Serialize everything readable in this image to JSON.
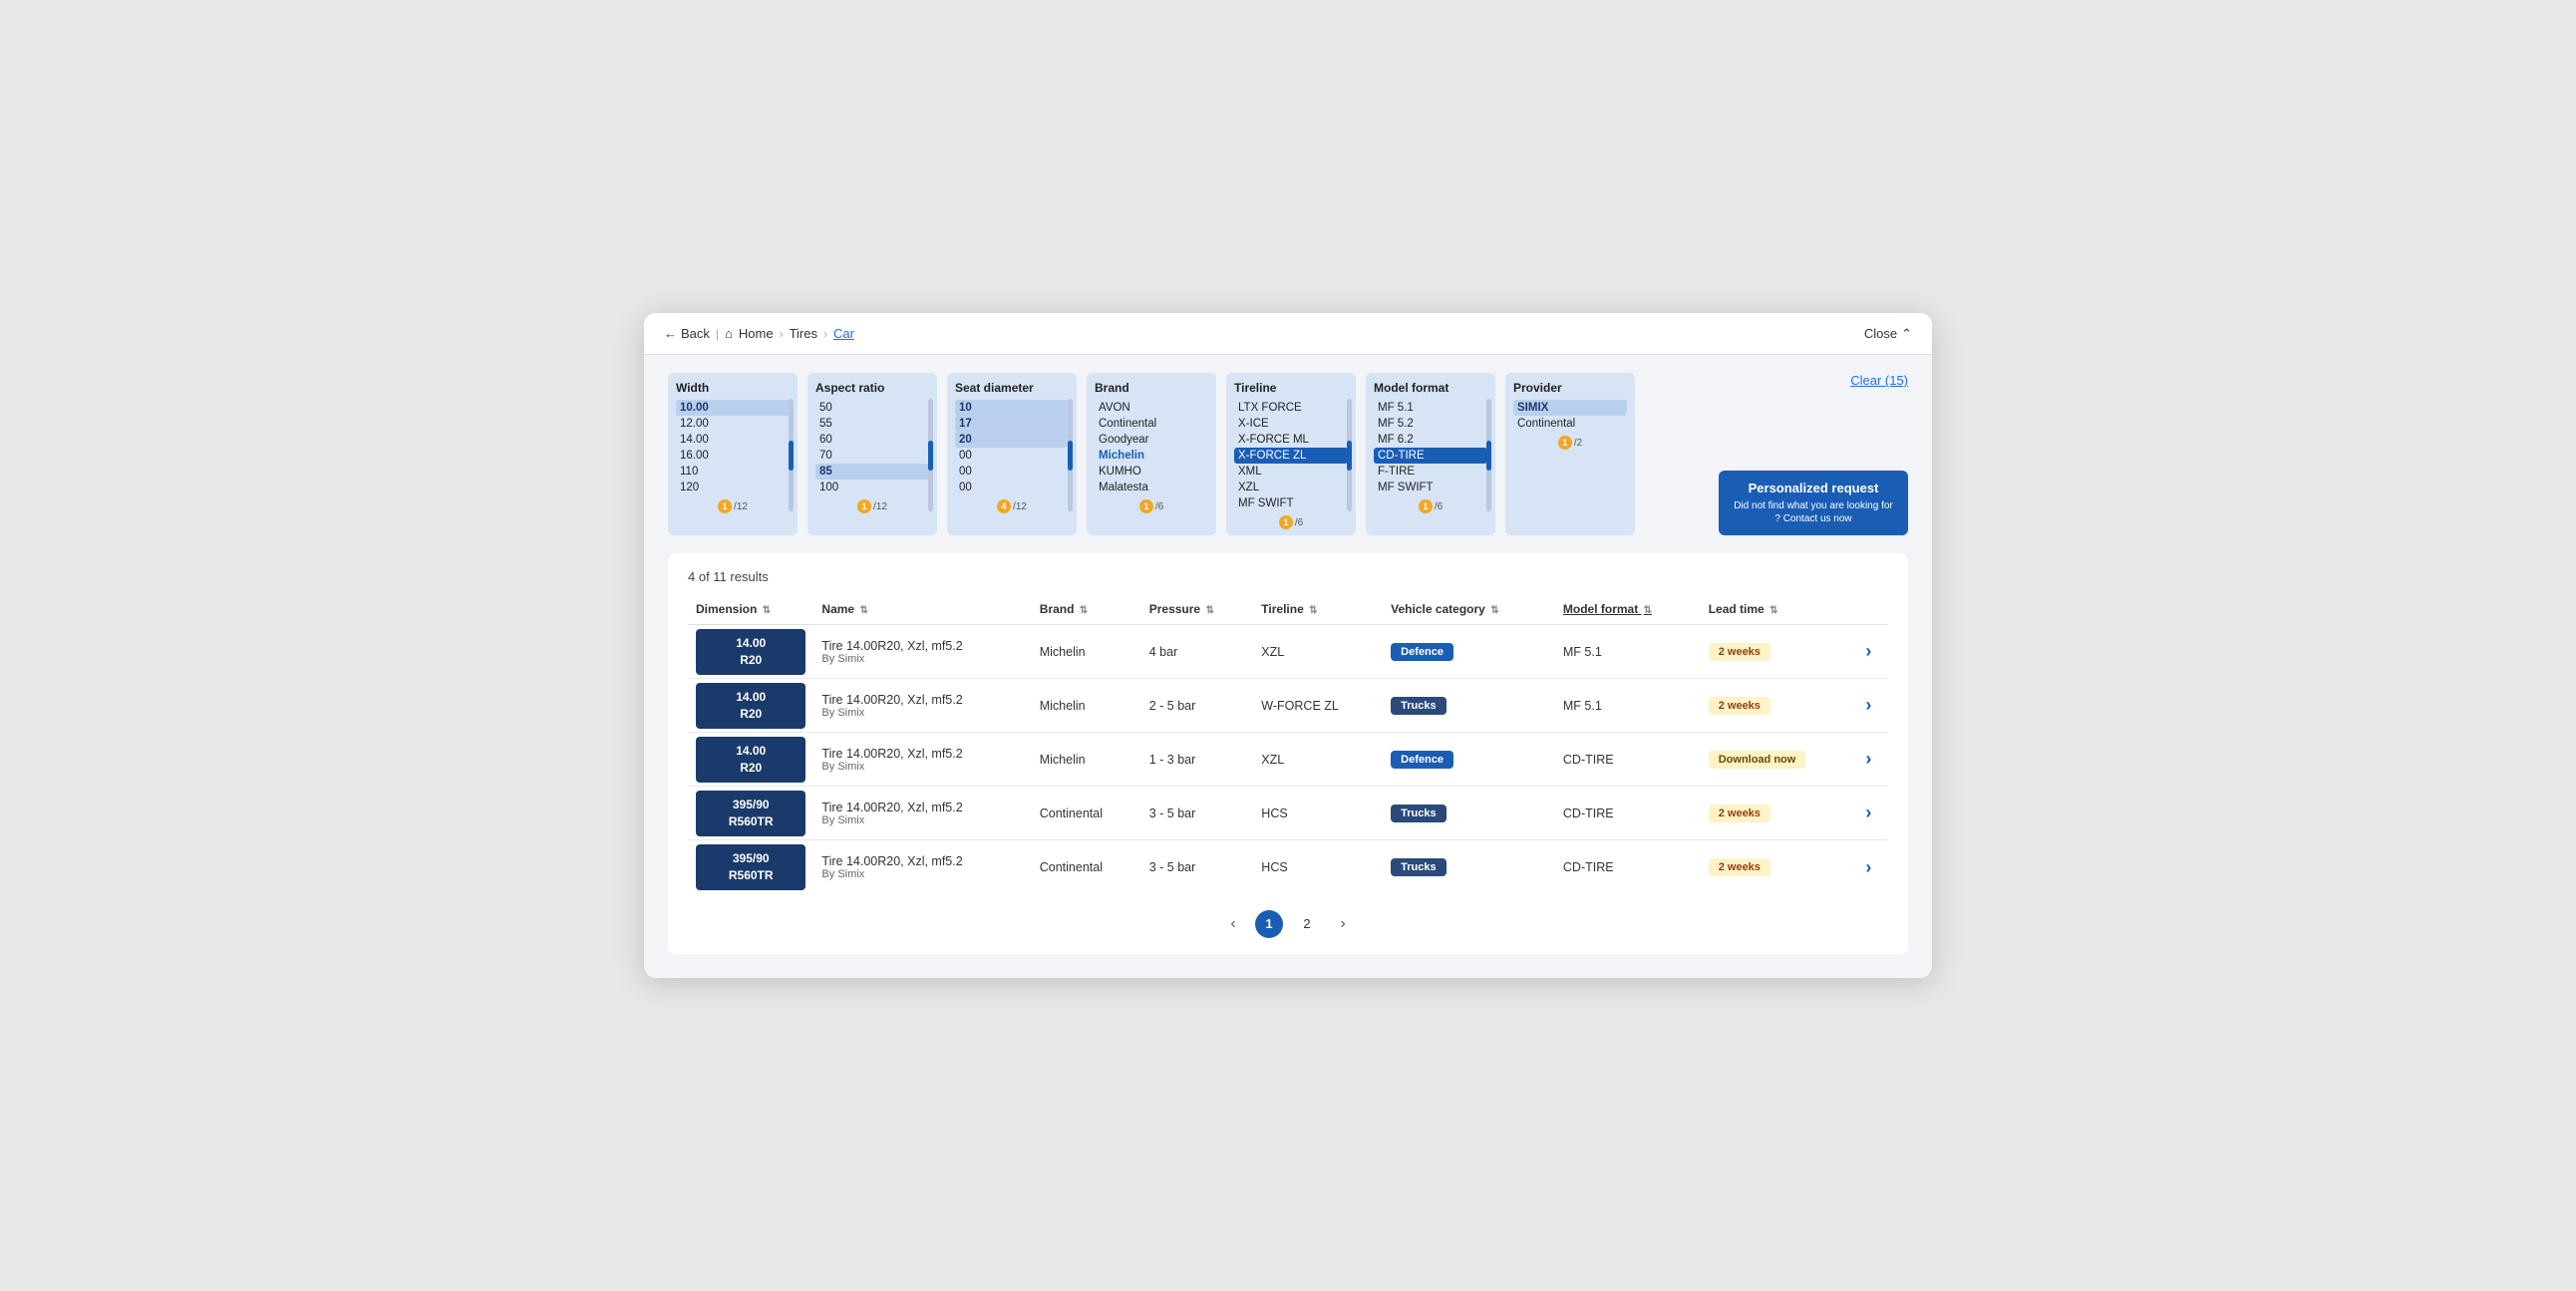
{
  "window": {
    "title": "Car"
  },
  "header": {
    "back_label": "Back",
    "breadcrumb": [
      "Home",
      "Tires",
      "Car"
    ],
    "close_label": "Close"
  },
  "filters": {
    "clear_label": "Clear (15)",
    "columns": [
      {
        "id": "width",
        "title": "Width",
        "items": [
          "10.00",
          "12.00",
          "14.00",
          "16.00",
          "110",
          "120"
        ],
        "selected": [
          "10.00"
        ],
        "highlighted": [],
        "counter": "1",
        "total": "12"
      },
      {
        "id": "aspect_ratio",
        "title": "Aspect ratio",
        "items": [
          "50",
          "55",
          "60",
          "70",
          "85",
          "100"
        ],
        "selected": [],
        "highlighted": [
          "85"
        ],
        "counter": "1",
        "total": "12"
      },
      {
        "id": "seat_diameter",
        "title": "Seat diameter",
        "items": [
          "10",
          "17",
          "20",
          "00",
          "00",
          "00"
        ],
        "selected": [
          "10",
          "17",
          "20"
        ],
        "highlighted": [],
        "counter": "4",
        "total": "12"
      },
      {
        "id": "brand",
        "title": "Brand",
        "items": [
          "AVON",
          "Continental",
          "Goodyear",
          "Michelin",
          "KUMHO",
          "Malatesta"
        ],
        "selected": [],
        "highlighted": [
          "Michelin"
        ],
        "counter": "1",
        "total": "6"
      },
      {
        "id": "tireline",
        "title": "Tireline",
        "items": [
          "LTX FORCE",
          "X-ICE",
          "X-FORCE ML",
          "X-FORCE ZL",
          "XML",
          "XZL",
          "MF SWIFT"
        ],
        "selected": [
          "X-FORCE ZL"
        ],
        "highlighted": [],
        "counter": "1",
        "total": "6"
      },
      {
        "id": "model_format",
        "title": "Model format",
        "items": [
          "MF 5.1",
          "MF 5.2",
          "MF 6.2",
          "CD-TIRE",
          "F-TIRE",
          "MF SWIFT"
        ],
        "selected": [
          "CD-TIRE"
        ],
        "highlighted": [],
        "counter": "1",
        "total": "6"
      },
      {
        "id": "provider",
        "title": "Provider",
        "items": [
          "SIMIX",
          "Continental"
        ],
        "selected": [
          "SIMIX"
        ],
        "highlighted": [],
        "counter": "1",
        "total": "2"
      }
    ]
  },
  "personalized": {
    "title": "Personalized request",
    "subtitle": "Did not find what you are looking for ? Contact us now"
  },
  "results": {
    "summary": "4 of 11 results",
    "columns": [
      "Dimension",
      "Name",
      "Brand",
      "Pressure",
      "Tireline",
      "Vehicle category",
      "Model format",
      "Lead time",
      ""
    ],
    "rows": [
      {
        "dimension": "14.00\nR20",
        "name": "Tire 14.00R20, Xzl, mf5.2\nBy Simix",
        "brand": "Michelin",
        "pressure": "4 bar",
        "tireline": "XZL",
        "vehicle_category": "Defence",
        "vehicle_badge": "defence",
        "model_format": "MF 5.1",
        "lead_time": "2 weeks",
        "lead_type": "normal"
      },
      {
        "dimension": "14.00\nR20",
        "name": "Tire 14.00R20, Xzl, mf5.2\nBy Simix",
        "brand": "Michelin",
        "pressure": "2 - 5 bar",
        "tireline": "W-FORCE ZL",
        "vehicle_category": "Trucks",
        "vehicle_badge": "trucks",
        "model_format": "MF 5.1",
        "lead_time": "2 weeks",
        "lead_type": "normal"
      },
      {
        "dimension": "14.00\nR20",
        "name": "Tire 14.00R20, Xzl, mf5.2\nBy Simix",
        "brand": "Michelin",
        "pressure": "1 - 3 bar",
        "tireline": "XZL",
        "vehicle_category": "Defence",
        "vehicle_badge": "defence",
        "model_format": "CD-TIRE",
        "lead_time": "Download now",
        "lead_type": "download"
      },
      {
        "dimension": "395/90\nR560TR",
        "name": "Tire 14.00R20, Xzl, mf5.2\nBy Simix",
        "brand": "Continental",
        "pressure": "3 - 5 bar",
        "tireline": "HCS",
        "vehicle_category": "Trucks",
        "vehicle_badge": "trucks",
        "model_format": "CD-TIRE",
        "lead_time": "2 weeks",
        "lead_type": "normal"
      },
      {
        "dimension": "395/90\nR560TR",
        "name": "Tire 14.00R20, Xzl, mf5.2\nBy Simix",
        "brand": "Continental",
        "pressure": "3 - 5 bar",
        "tireline": "HCS",
        "vehicle_category": "Trucks",
        "vehicle_badge": "trucks",
        "model_format": "CD-TIRE",
        "lead_time": "2 weeks",
        "lead_type": "normal"
      }
    ]
  },
  "pagination": {
    "prev": "‹",
    "next": "›",
    "pages": [
      "1",
      "2"
    ],
    "current": "1"
  }
}
